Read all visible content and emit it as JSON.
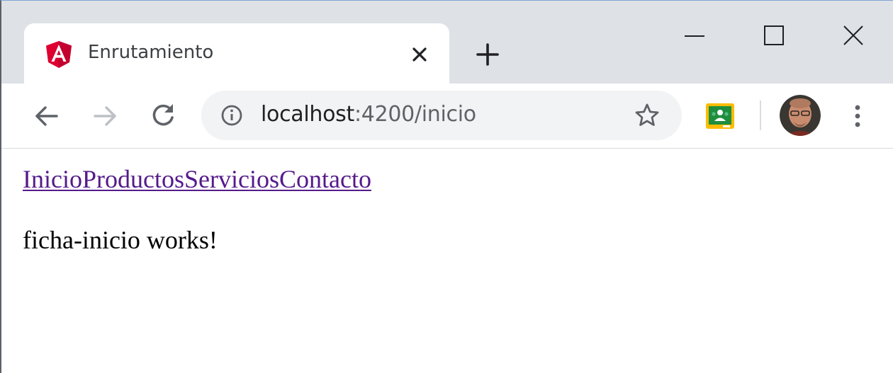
{
  "tab": {
    "title": "Enrutamiento",
    "favicon_icon": "angular-icon"
  },
  "window_controls": {
    "minimize_icon": "minimize-icon",
    "maximize_icon": "maximize-icon",
    "close_icon": "close-icon"
  },
  "toolbar": {
    "back_icon": "arrow-left-icon",
    "forward_icon": "arrow-right-icon",
    "reload_icon": "reload-icon",
    "url_host": "localhost",
    "url_path": ":4200/inicio",
    "info_icon": "info-icon",
    "bookmark_icon": "star-icon",
    "extension_icon": "google-classroom-icon",
    "menu_icon": "kebab-menu-icon"
  },
  "page": {
    "links": [
      "Inicio",
      "Productos",
      "Servicios",
      "Contacto"
    ],
    "message": "ficha-inicio works!"
  },
  "colors": {
    "tabstrip_bg": "#dee1e6",
    "omnibox_bg": "#f1f3f4",
    "visited_link": "#551a8b",
    "angular_red": "#dd0031",
    "classroom_green": "#1e8e3e",
    "classroom_yellow": "#fbbc04"
  }
}
